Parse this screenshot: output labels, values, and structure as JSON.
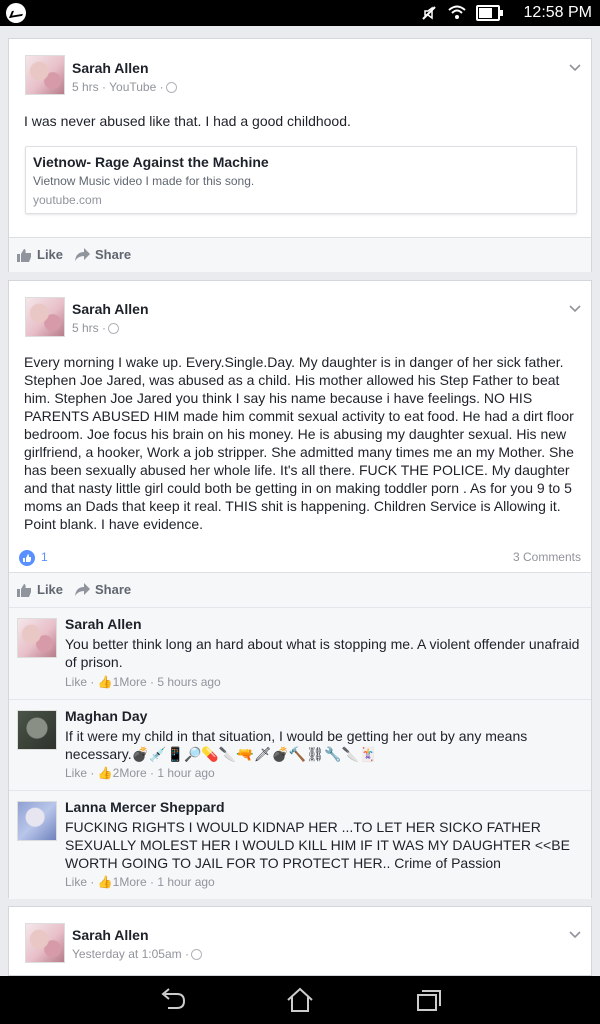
{
  "status": {
    "time": "12:58 PM"
  },
  "posts": [
    {
      "author": "Sarah Allen",
      "meta": "5 hrs · YouTube ·",
      "text": "I was never abused like that. I had a good childhood.",
      "link": {
        "title": "Vietnow- Rage Against the Machine",
        "desc": "Vietnow Music video I made for this song.",
        "domain": "youtube.com"
      },
      "actions": {
        "like": "Like",
        "share": "Share"
      }
    },
    {
      "author": "Sarah Allen",
      "meta": "5 hrs ·",
      "text": "Every morning I wake up. Every.Single.Day. My daughter is in danger of her sick father. Stephen Joe Jared, was abused as a child. His mother allowed his Step Father to beat him. Stephen Joe Jared you think I say his name because i have feelings. NO HIS PARENTS ABUSED HIM made him commit sexual activity to eat food. He had a dirt floor bedroom. Joe focus his brain on his money. He is abusing my daughter sexual. His new girlfriend, a hooker, Work a job stripper. She admitted many times me an my Mother. She has been sexually abused her whole life. It's all there. FUCK THE POLICE. My daughter and that nasty little girl could both be getting in on making toddler porn . As for you 9 to 5 moms an Dads that keep it real. THIS shit is happening. Children Service is Allowing it. Point blank. I have evidence.",
      "reactions": {
        "count": "1",
        "comments": "3 Comments"
      },
      "actions": {
        "like": "Like",
        "share": "Share"
      },
      "comments": [
        {
          "name": "Sarah Allen",
          "text": "You better think long an hard about what is stopping me. A violent offender unafraid of prison.",
          "like": "Like",
          "count": "1",
          "more": "More",
          "time": "5 hours ago"
        },
        {
          "name": "Maghan Day",
          "text": "If it were my child in that situation, I would be getting her out by any means necessary.💣💉📱🔎💊🔪🔫🗡💣🔨⛓🔧🔪🃏",
          "like": "Like",
          "count": "2",
          "more": "More",
          "time": "1 hour ago"
        },
        {
          "name": "Lanna Mercer Sheppard",
          "text": "FUCKING RIGHTS I WOULD KIDNAP HER ...TO LET HER SICKO FATHER SEXUALLY MOLEST HER I WOULD KILL HIM IF IT WAS MY DAUGHTER <<BE WORTH GOING TO JAIL FOR TO PROTECT HER.. Crime of Passion",
          "like": "Like",
          "count": "1",
          "more": "More",
          "time": "1 hour ago"
        }
      ]
    },
    {
      "author": "Sarah Allen",
      "meta": "Yesterday at 1:05am ·"
    }
  ],
  "colors": {
    "accent": "#5890ff",
    "background": "#e9ebee"
  }
}
